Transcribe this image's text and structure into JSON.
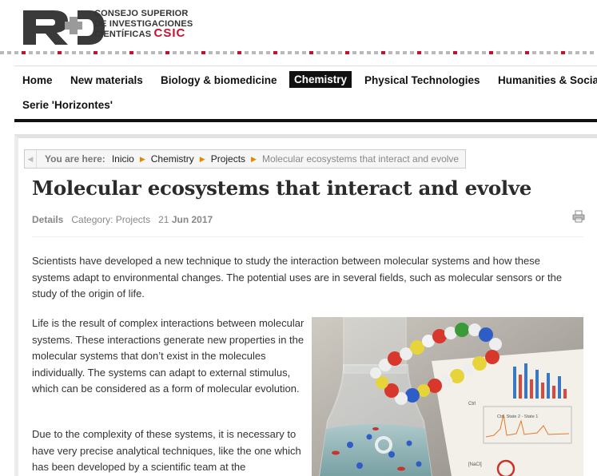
{
  "header": {
    "logo_mark": "R+D",
    "org_line1": "CONSEJO SUPERIOR",
    "org_line2": "DE INVESTIGACIONES",
    "org_line3": "CIENTÍFICAS",
    "org_short": "CSIC",
    "brand_red": "#c8102e"
  },
  "nav": {
    "items": [
      {
        "label": "Home"
      },
      {
        "label": "New materials"
      },
      {
        "label": "Biology & biomedicine"
      },
      {
        "label": "Chemistry",
        "active": true
      },
      {
        "label": "Physical Technologies"
      },
      {
        "label": "Humanities & Socia"
      },
      {
        "label": "Serie 'Horizontes'"
      }
    ]
  },
  "breadcrumb": {
    "label": "You are here:",
    "items": [
      "Inicio",
      "Chemistry",
      "Projects"
    ],
    "current": "Molecular ecosystems that interact and evolve"
  },
  "article": {
    "title": "Molecular ecosystems that interact and evolve",
    "details_label": "Details",
    "category": "Category: Projects",
    "date_day": "21",
    "date_month_year": "Jun 2017",
    "print_icon": "printer-icon",
    "intro": "Scientists have developed a new technique to study the interaction between molecular systems and how these systems adapt to environmental changes. The potential uses are in several fields, such as molecular sensors or the study of the origin of life.",
    "paragraph1": "Life is the result of complex interactions between molecular systems. These interactions generate new properties in the molecular systems that don’t  exist in the molecules individually. The systems can adapt to external stimulus, which can be considered as a form of molecular evolution.",
    "paragraph2": "Due to the complexity of these systems, it is necessary to have very precise analytical techniques, like the one which has been developed by a scientific team at the",
    "figure_labels": [
      "[NaCl]",
      "Ctrl",
      "Ctrl. State 2 - State 1"
    ]
  }
}
